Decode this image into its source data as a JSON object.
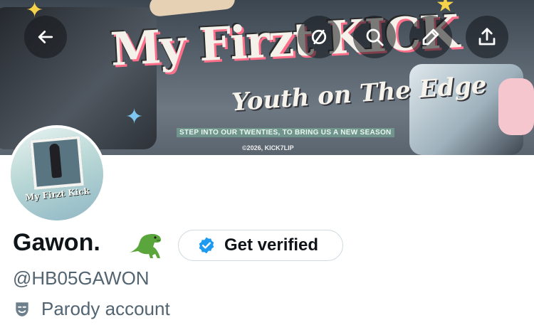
{
  "banner": {
    "title": "My Firzt KICK",
    "subtitle": "Youth on The Edge",
    "tagline": "STEP INTO OUR TWENTIES, TO BRING US A NEW SEASON",
    "copyright": "©2026, KICK7LIP"
  },
  "avatar": {
    "logo_text": "My Firzt Kick"
  },
  "header_actions": [
    {
      "name": "back-arrow-icon"
    },
    {
      "name": "circle-slash-icon"
    },
    {
      "name": "search-icon"
    },
    {
      "name": "pencil-icon"
    },
    {
      "name": "share-icon"
    }
  ],
  "profile": {
    "display_name": "Gawon.",
    "name_emoji": "t-rex-icon",
    "handle": "@HB05GAWON",
    "label_text": "Parody account",
    "label_icon": "theater-mask-icon"
  },
  "verify_button": {
    "label": "Get verified",
    "badge_color": "#1d9bf0"
  },
  "colors": {
    "text_primary": "#0f1419",
    "text_secondary": "#536471",
    "border": "#cfd9de"
  }
}
